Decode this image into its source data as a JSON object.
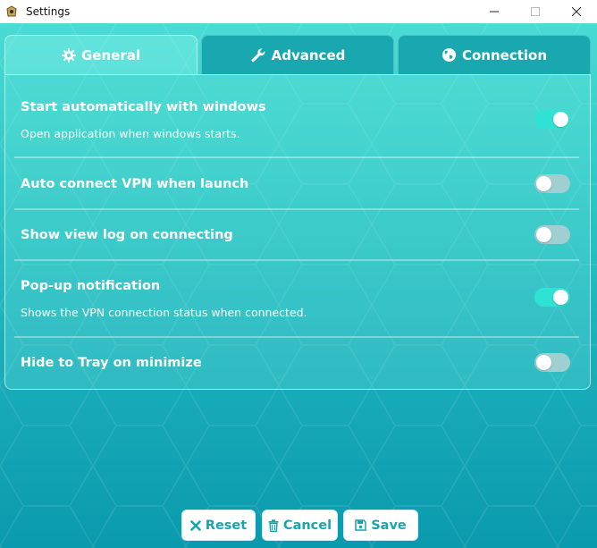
{
  "window": {
    "title": "Settings"
  },
  "tabs": [
    {
      "label": "General",
      "icon": "gear-icon",
      "active": true
    },
    {
      "label": "Advanced",
      "icon": "wrench-icon",
      "active": false
    },
    {
      "label": "Connection",
      "icon": "globe-icon",
      "active": false
    }
  ],
  "settings": [
    {
      "title": "Start automatically with windows",
      "description": "Open application when windows starts.",
      "enabled": true
    },
    {
      "title": "Auto connect VPN when launch",
      "description": "",
      "enabled": false
    },
    {
      "title": "Show view log on connecting",
      "description": "",
      "enabled": false
    },
    {
      "title": "Pop-up notification",
      "description": "Shows the VPN connection status when connected.",
      "enabled": true
    },
    {
      "title": "Hide to Tray on minimize",
      "description": "",
      "enabled": false
    }
  ],
  "buttons": {
    "reset": "Reset",
    "cancel": "Cancel",
    "save": "Save"
  },
  "colors": {
    "accent": "#1aa4ae",
    "toggle_on": "#2fe3d4",
    "toggle_off": "#9fcfd1"
  }
}
